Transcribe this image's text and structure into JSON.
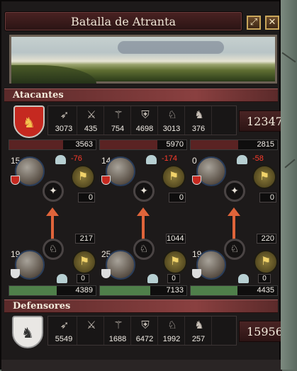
{
  "window": {
    "title": "Batalla de Atranta",
    "min_label": "⤢",
    "close_label": "✕"
  },
  "attackers": {
    "section_label": "Atacantes",
    "shield_glyph": "♞",
    "units": [
      {
        "icon": "archer-icon",
        "glyph": "➶",
        "count": "3073"
      },
      {
        "icon": "light-infantry-icon",
        "glyph": "⚔",
        "count": "435"
      },
      {
        "icon": "pikemen-icon",
        "glyph": "⚚",
        "count": "754"
      },
      {
        "icon": "heavy-infantry-icon",
        "glyph": "⛨",
        "count": "4698"
      },
      {
        "icon": "light-cavalry-icon",
        "glyph": "♘",
        "count": "3013"
      },
      {
        "icon": "knights-icon",
        "glyph": "♞",
        "count": "376"
      }
    ],
    "total": "12347"
  },
  "defenders": {
    "section_label": "Defensores",
    "shield_glyph": "♞",
    "units": [
      {
        "icon": "archer-icon",
        "glyph": "➶",
        "count": "5549"
      },
      {
        "icon": "light-infantry-icon",
        "glyph": "⚔",
        "count": ""
      },
      {
        "icon": "pikemen-icon",
        "glyph": "⚚",
        "count": "1688"
      },
      {
        "icon": "heavy-infantry-icon",
        "glyph": "⛨",
        "count": "6472"
      },
      {
        "icon": "light-cavalry-icon",
        "glyph": "♘",
        "count": "1992"
      },
      {
        "icon": "knights-icon",
        "glyph": "♞",
        "count": "257"
      }
    ],
    "total": "15956"
  },
  "flanks": [
    {
      "top": {
        "troops": "3563",
        "troops_fraction": 0.62,
        "level": "15",
        "delta": "-76",
        "tactic_value": "0"
      },
      "attack_power": "217",
      "bottom": {
        "troops": "4389",
        "troops_fraction": 0.55,
        "level": "19",
        "tactic_value": "0"
      }
    },
    {
      "top": {
        "troops": "5970",
        "troops_fraction": 0.66,
        "level": "14",
        "delta": "-174",
        "tactic_value": "0"
      },
      "attack_power": "1044",
      "bottom": {
        "troops": "7133",
        "troops_fraction": 0.58,
        "level": "25",
        "tactic_value": "0"
      }
    },
    {
      "top": {
        "troops": "2815",
        "troops_fraction": 0.55,
        "level": "0",
        "delta": "-58",
        "tactic_value": "0"
      },
      "attack_power": "220",
      "bottom": {
        "troops": "4435",
        "troops_fraction": 0.54,
        "level": "19",
        "tactic_value": "0"
      }
    }
  ],
  "colors": {
    "attacker_bar": "#5a2323",
    "defender_bar": "#4f7f4a",
    "arrow": "#e0643a"
  }
}
